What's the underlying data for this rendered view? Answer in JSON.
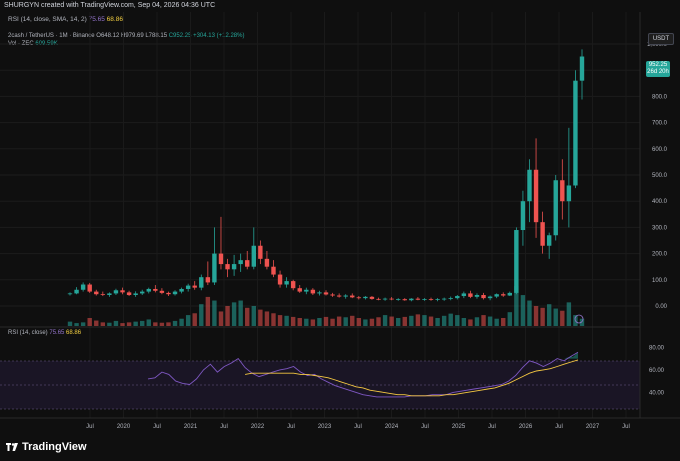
{
  "header": {
    "attribution": "SHURGYN created with TradingView.com, Sep 04, 2026 04:36 UTC"
  },
  "rsi_header": {
    "label": "RSI (14, close, SMA, 14, 2)",
    "rsi_value": "75.65",
    "sma_value": "68.86"
  },
  "symbol": {
    "pair": "2cash / TetherUS · 1M · Binance",
    "open": "O648.12",
    "high": "H979.69",
    "low": "L788.15",
    "close": "C952.25",
    "change": "+304.13 (+12.28%)"
  },
  "volume": {
    "label": "Vol · ZEC",
    "value": "609.59K"
  },
  "rsi_pane": {
    "label": "RSI (14, close)",
    "rsi_value": "75.65",
    "sma_value": "68.86"
  },
  "axis": {
    "unit": "USDT",
    "price_tag": "952.25",
    "countdown": "26d 20h"
  },
  "footer": {
    "brand": "TradingView"
  },
  "colors": {
    "up": "#26a69a",
    "down": "#ef5350",
    "rsi": "#7e57c2",
    "sma": "#f5c842",
    "bg": "#0f0f0f"
  },
  "chart_data": [
    {
      "type": "candlestick",
      "title": "2cash / TetherUS · 1M · Binance",
      "ylim": [
        -40,
        1050
      ],
      "y_ticks": [
        "0.00",
        "100.0",
        "200.0",
        "300.0",
        "400.0",
        "500.0",
        "600.0",
        "700.0",
        "800.0",
        "900.0",
        "1,000.0"
      ],
      "x_ticks": [
        "Jul",
        "2020",
        "Jul",
        "2021",
        "Jul",
        "2022",
        "Jul",
        "2023",
        "Jul",
        "2024",
        "Jul",
        "2025",
        "Jul",
        "2026",
        "Jul",
        "2027",
        "Jul"
      ],
      "candles": [
        [
          45,
          52,
          40,
          48
        ],
        [
          48,
          72,
          45,
          62
        ],
        [
          62,
          90,
          55,
          82
        ],
        [
          82,
          88,
          50,
          55
        ],
        [
          55,
          62,
          40,
          45
        ],
        [
          45,
          55,
          38,
          42
        ],
        [
          42,
          52,
          35,
          48
        ],
        [
          48,
          66,
          42,
          60
        ],
        [
          60,
          70,
          45,
          52
        ],
        [
          52,
          58,
          38,
          42
        ],
        [
          42,
          56,
          35,
          48
        ],
        [
          48,
          62,
          42,
          55
        ],
        [
          55,
          70,
          48,
          65
        ],
        [
          65,
          80,
          52,
          58
        ],
        [
          58,
          68,
          45,
          50
        ],
        [
          50,
          55,
          38,
          45
        ],
        [
          45,
          60,
          40,
          55
        ],
        [
          55,
          70,
          48,
          65
        ],
        [
          65,
          85,
          55,
          78
        ],
        [
          78,
          95,
          62,
          70
        ],
        [
          70,
          120,
          60,
          110
        ],
        [
          110,
          170,
          80,
          90
        ],
        [
          90,
          300,
          80,
          200
        ],
        [
          200,
          340,
          140,
          160
        ],
        [
          160,
          180,
          110,
          140
        ],
        [
          140,
          195,
          115,
          160
        ],
        [
          160,
          200,
          130,
          175
        ],
        [
          175,
          210,
          140,
          150
        ],
        [
          150,
          300,
          140,
          230
        ],
        [
          230,
          250,
          160,
          180
        ],
        [
          180,
          210,
          140,
          150
        ],
        [
          150,
          175,
          110,
          120
        ],
        [
          120,
          135,
          70,
          82
        ],
        [
          82,
          110,
          70,
          95
        ],
        [
          95,
          100,
          60,
          68
        ],
        [
          68,
          80,
          50,
          55
        ],
        [
          55,
          70,
          45,
          62
        ],
        [
          62,
          68,
          42,
          48
        ],
        [
          48,
          58,
          40,
          52
        ],
        [
          52,
          60,
          40,
          44
        ],
        [
          44,
          50,
          35,
          40
        ],
        [
          40,
          48,
          32,
          36
        ],
        [
          36,
          45,
          28,
          40
        ],
        [
          40,
          48,
          30,
          33
        ],
        [
          33,
          38,
          25,
          30
        ],
        [
          30,
          38,
          25,
          35
        ],
        [
          35,
          38,
          24,
          27
        ],
        [
          27,
          32,
          22,
          25
        ],
        [
          25,
          32,
          20,
          28
        ],
        [
          28,
          34,
          22,
          25
        ],
        [
          25,
          30,
          20,
          26
        ],
        [
          26,
          30,
          20,
          22
        ],
        [
          22,
          30,
          18,
          28
        ],
        [
          28,
          34,
          22,
          24
        ],
        [
          24,
          30,
          20,
          26
        ],
        [
          26,
          32,
          20,
          24
        ],
        [
          24,
          30,
          18,
          26
        ],
        [
          26,
          32,
          20,
          28
        ],
        [
          28,
          36,
          22,
          30
        ],
        [
          30,
          42,
          25,
          38
        ],
        [
          38,
          55,
          30,
          48
        ],
        [
          48,
          58,
          30,
          35
        ],
        [
          35,
          48,
          28,
          42
        ],
        [
          42,
          50,
          25,
          30
        ],
        [
          30,
          40,
          22,
          36
        ],
        [
          36,
          48,
          30,
          45
        ],
        [
          45,
          52,
          35,
          40
        ],
        [
          40,
          55,
          38,
          50
        ],
        [
          50,
          300,
          45,
          290
        ],
        [
          290,
          440,
          230,
          400
        ],
        [
          400,
          560,
          320,
          520
        ],
        [
          520,
          640,
          260,
          320
        ],
        [
          320,
          360,
          200,
          230
        ],
        [
          230,
          280,
          180,
          270
        ],
        [
          270,
          500,
          250,
          480
        ],
        [
          480,
          560,
          330,
          400
        ],
        [
          400,
          680,
          300,
          460
        ],
        [
          460,
          900,
          450,
          860
        ],
        [
          860,
          979.69,
          788.15,
          952.25
        ]
      ],
      "volume": [
        12,
        8,
        10,
        22,
        15,
        10,
        9,
        14,
        8,
        10,
        12,
        14,
        18,
        10,
        9,
        10,
        14,
        20,
        30,
        35,
        60,
        80,
        70,
        40,
        55,
        65,
        70,
        50,
        55,
        45,
        40,
        35,
        30,
        28,
        25,
        22,
        20,
        18,
        22,
        25,
        20,
        26,
        24,
        28,
        22,
        18,
        20,
        24,
        30,
        26,
        22,
        25,
        28,
        32,
        30,
        26,
        22,
        28,
        34,
        30,
        22,
        18,
        24,
        30,
        26,
        20,
        22,
        38,
        110,
        85,
        70,
        55,
        50,
        60,
        48,
        42,
        65,
        30,
        20
      ],
      "rsi_pane": {
        "ylim": [
          20,
          90
        ],
        "y_ticks": [
          "40.00",
          "60.00",
          "80.00"
        ],
        "rsi": [
          52,
          53,
          58,
          56,
          50,
          48,
          47,
          52,
          60,
          65,
          58,
          63,
          66,
          70,
          62,
          57,
          54,
          56,
          58,
          60,
          61,
          63,
          58,
          55,
          56,
          52,
          49,
          46,
          44,
          42,
          40,
          38,
          37,
          36,
          36,
          36,
          36,
          36,
          37,
          37,
          37,
          38,
          38,
          38,
          40,
          41,
          42,
          43,
          44,
          45,
          46,
          47,
          50,
          55,
          62,
          68,
          66,
          63,
          66,
          70,
          68,
          72,
          75.65
        ],
        "sma": [
          null,
          null,
          null,
          null,
          null,
          null,
          null,
          null,
          null,
          null,
          null,
          null,
          null,
          null,
          56,
          57,
          57,
          57,
          57,
          57,
          57,
          57,
          56,
          56,
          55,
          54,
          53,
          51,
          49,
          47,
          45,
          44,
          42,
          41,
          40,
          39,
          38,
          38,
          37,
          37,
          37,
          37,
          37,
          38,
          38,
          39,
          40,
          41,
          42,
          43,
          44,
          46,
          48,
          51,
          54,
          57,
          59,
          60,
          61,
          63,
          65,
          67,
          68.86
        ]
      }
    }
  ]
}
